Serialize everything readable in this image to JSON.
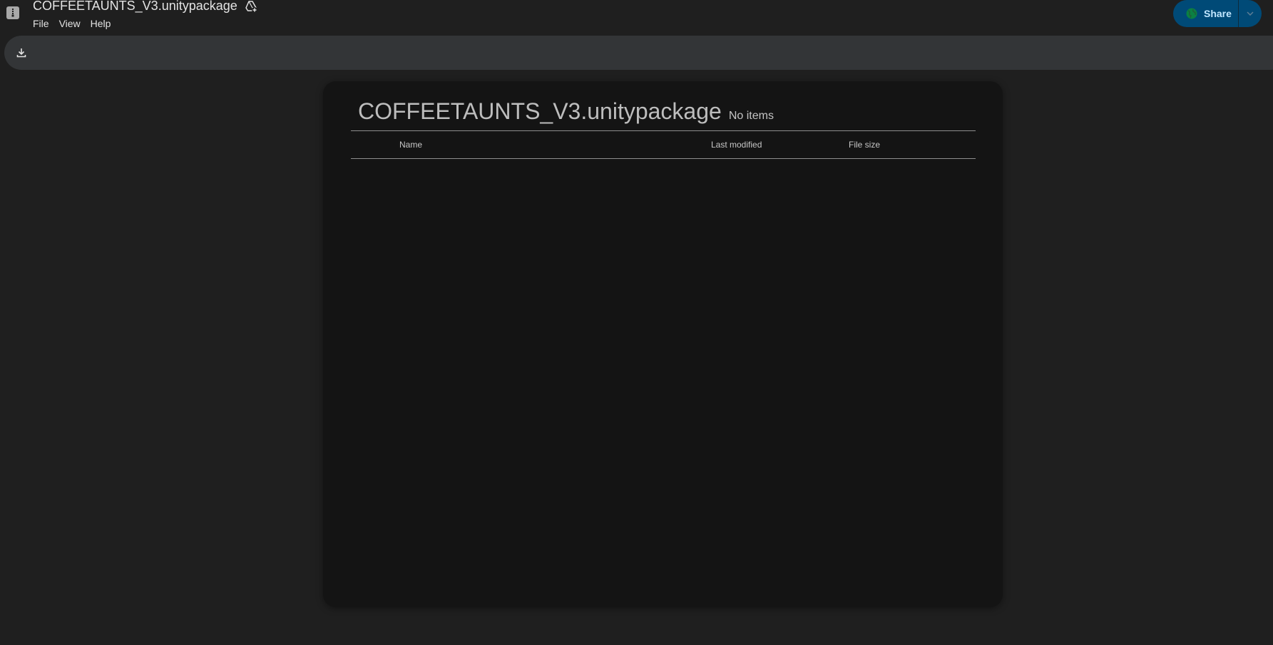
{
  "header": {
    "title": "COFFEETAUNTS_V3.unitypackage",
    "menu": [
      {
        "label": "File"
      },
      {
        "label": "View"
      },
      {
        "label": "Help"
      }
    ],
    "share_label": "Share"
  },
  "toolbar": {
    "download_icon": "download-icon"
  },
  "archive": {
    "title": "COFFEETAUNTS_V3.unitypackage",
    "item_count": "No items",
    "columns": {
      "name": "Name",
      "last_modified": "Last modified",
      "file_size": "File size"
    },
    "rows": []
  },
  "colors": {
    "background": "#1f1f1f",
    "toolbar": "#333537",
    "panel": "#141414",
    "share_button": "#004a77",
    "share_text": "#c2e7ff"
  }
}
